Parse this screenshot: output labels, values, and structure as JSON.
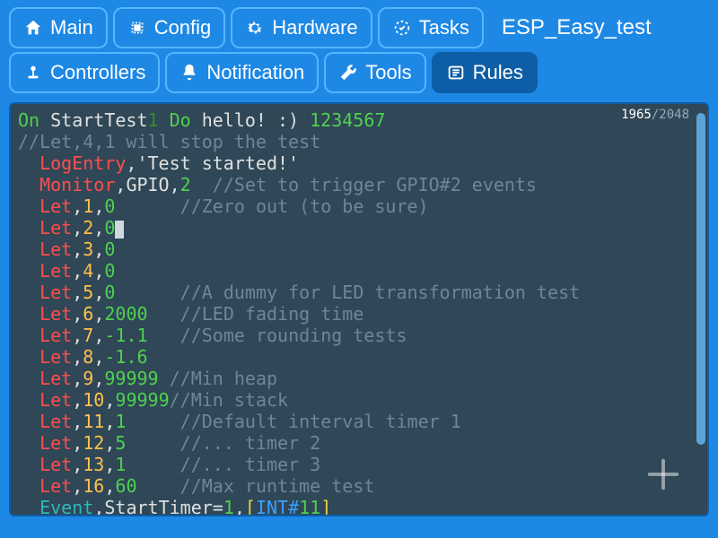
{
  "app_title": "ESP_Easy_test",
  "tabs_row1": [
    {
      "id": "main",
      "label": "Main",
      "icon": "home"
    },
    {
      "id": "config",
      "label": "Config",
      "icon": "chip"
    },
    {
      "id": "hardware",
      "label": "Hardware",
      "icon": "gear"
    },
    {
      "id": "tasks",
      "label": "Tasks",
      "icon": "tasks"
    }
  ],
  "tabs_row2": [
    {
      "id": "controllers",
      "label": "Controllers",
      "icon": "joystick"
    },
    {
      "id": "notification",
      "label": "Notification",
      "icon": "bell"
    },
    {
      "id": "tools",
      "label": "Tools",
      "icon": "wrench"
    },
    {
      "id": "rules",
      "label": "Rules",
      "icon": "list",
      "active": true
    }
  ],
  "counter": {
    "current": "1965",
    "max": "2048"
  },
  "code": {
    "lines": [
      [
        {
          "cls": "kw",
          "t": "On "
        },
        {
          "cls": "txt",
          "t": "StartTest"
        },
        {
          "cls": "kw-dk",
          "t": "1 "
        },
        {
          "cls": "kw",
          "t": "Do "
        },
        {
          "cls": "txt",
          "t": "hello! :) "
        },
        {
          "cls": "kw",
          "t": "1234567"
        }
      ],
      [
        {
          "cls": "com",
          "t": "//Let,4,1 will stop the test"
        }
      ],
      [
        {
          "cls": "txt",
          "t": "  "
        },
        {
          "cls": "cmd",
          "t": "LogEntry"
        },
        {
          "cls": "txt",
          "t": ","
        },
        {
          "cls": "txt",
          "t": "'Test started!'"
        }
      ],
      [
        {
          "cls": "txt",
          "t": "  "
        },
        {
          "cls": "cmd",
          "t": "Monitor"
        },
        {
          "cls": "txt",
          "t": ","
        },
        {
          "cls": "txt",
          "t": "GPIO,"
        },
        {
          "cls": "kw",
          "t": "2"
        },
        {
          "cls": "txt",
          "t": "  "
        },
        {
          "cls": "com",
          "t": "//Set to trigger GPIO#2 events"
        }
      ],
      [
        {
          "cls": "txt",
          "t": "  "
        },
        {
          "cls": "cmd",
          "t": "Let"
        },
        {
          "cls": "txt",
          "t": ","
        },
        {
          "cls": "num",
          "t": "1"
        },
        {
          "cls": "txt",
          "t": ","
        },
        {
          "cls": "kw",
          "t": "0"
        },
        {
          "cls": "txt",
          "t": "      "
        },
        {
          "cls": "com",
          "t": "//Zero out (to be sure)"
        }
      ],
      [
        {
          "cls": "txt",
          "t": "  "
        },
        {
          "cls": "cmd",
          "t": "Let"
        },
        {
          "cls": "txt",
          "t": ","
        },
        {
          "cls": "num",
          "t": "2"
        },
        {
          "cls": "txt",
          "t": ","
        },
        {
          "cls": "kw",
          "t": "0"
        },
        {
          "cls": "cursor",
          "t": ""
        }
      ],
      [
        {
          "cls": "txt",
          "t": "  "
        },
        {
          "cls": "cmd",
          "t": "Let"
        },
        {
          "cls": "txt",
          "t": ","
        },
        {
          "cls": "num",
          "t": "3"
        },
        {
          "cls": "txt",
          "t": ","
        },
        {
          "cls": "kw",
          "t": "0"
        }
      ],
      [
        {
          "cls": "txt",
          "t": "  "
        },
        {
          "cls": "cmd",
          "t": "Let"
        },
        {
          "cls": "txt",
          "t": ","
        },
        {
          "cls": "num",
          "t": "4"
        },
        {
          "cls": "txt",
          "t": ","
        },
        {
          "cls": "kw",
          "t": "0"
        }
      ],
      [
        {
          "cls": "txt",
          "t": "  "
        },
        {
          "cls": "cmd",
          "t": "Let"
        },
        {
          "cls": "txt",
          "t": ","
        },
        {
          "cls": "num",
          "t": "5"
        },
        {
          "cls": "txt",
          "t": ","
        },
        {
          "cls": "kw",
          "t": "0"
        },
        {
          "cls": "txt",
          "t": "      "
        },
        {
          "cls": "com",
          "t": "//A dummy for LED transformation test"
        }
      ],
      [
        {
          "cls": "txt",
          "t": "  "
        },
        {
          "cls": "cmd",
          "t": "Let"
        },
        {
          "cls": "txt",
          "t": ","
        },
        {
          "cls": "num",
          "t": "6"
        },
        {
          "cls": "txt",
          "t": ","
        },
        {
          "cls": "kw",
          "t": "2000"
        },
        {
          "cls": "txt",
          "t": "   "
        },
        {
          "cls": "com",
          "t": "//LED fading time"
        }
      ],
      [
        {
          "cls": "txt",
          "t": "  "
        },
        {
          "cls": "cmd",
          "t": "Let"
        },
        {
          "cls": "txt",
          "t": ","
        },
        {
          "cls": "num",
          "t": "7"
        },
        {
          "cls": "txt",
          "t": ","
        },
        {
          "cls": "kw",
          "t": "-1.1"
        },
        {
          "cls": "txt",
          "t": "   "
        },
        {
          "cls": "com",
          "t": "//Some rounding tests"
        }
      ],
      [
        {
          "cls": "txt",
          "t": "  "
        },
        {
          "cls": "cmd",
          "t": "Let"
        },
        {
          "cls": "txt",
          "t": ","
        },
        {
          "cls": "num",
          "t": "8"
        },
        {
          "cls": "txt",
          "t": ","
        },
        {
          "cls": "kw",
          "t": "-1.6"
        }
      ],
      [
        {
          "cls": "txt",
          "t": "  "
        },
        {
          "cls": "cmd",
          "t": "Let"
        },
        {
          "cls": "txt",
          "t": ","
        },
        {
          "cls": "num",
          "t": "9"
        },
        {
          "cls": "txt",
          "t": ","
        },
        {
          "cls": "kw",
          "t": "99999"
        },
        {
          "cls": "txt",
          "t": " "
        },
        {
          "cls": "com",
          "t": "//Min heap"
        }
      ],
      [
        {
          "cls": "txt",
          "t": "  "
        },
        {
          "cls": "cmd",
          "t": "Let"
        },
        {
          "cls": "txt",
          "t": ","
        },
        {
          "cls": "num",
          "t": "10"
        },
        {
          "cls": "txt",
          "t": ","
        },
        {
          "cls": "kw",
          "t": "99999"
        },
        {
          "cls": "com",
          "t": "//Min stack"
        }
      ],
      [
        {
          "cls": "txt",
          "t": "  "
        },
        {
          "cls": "cmd",
          "t": "Let"
        },
        {
          "cls": "txt",
          "t": ","
        },
        {
          "cls": "num",
          "t": "11"
        },
        {
          "cls": "txt",
          "t": ","
        },
        {
          "cls": "kw",
          "t": "1"
        },
        {
          "cls": "txt",
          "t": "     "
        },
        {
          "cls": "com",
          "t": "//Default interval timer 1"
        }
      ],
      [
        {
          "cls": "txt",
          "t": "  "
        },
        {
          "cls": "cmd",
          "t": "Let"
        },
        {
          "cls": "txt",
          "t": ","
        },
        {
          "cls": "num",
          "t": "12"
        },
        {
          "cls": "txt",
          "t": ","
        },
        {
          "cls": "kw",
          "t": "5"
        },
        {
          "cls": "txt",
          "t": "     "
        },
        {
          "cls": "com",
          "t": "//... timer 2"
        }
      ],
      [
        {
          "cls": "txt",
          "t": "  "
        },
        {
          "cls": "cmd",
          "t": "Let"
        },
        {
          "cls": "txt",
          "t": ","
        },
        {
          "cls": "num",
          "t": "13"
        },
        {
          "cls": "txt",
          "t": ","
        },
        {
          "cls": "kw",
          "t": "1"
        },
        {
          "cls": "txt",
          "t": "     "
        },
        {
          "cls": "com",
          "t": "//... timer 3"
        }
      ],
      [
        {
          "cls": "txt",
          "t": "  "
        },
        {
          "cls": "cmd",
          "t": "Let"
        },
        {
          "cls": "txt",
          "t": ","
        },
        {
          "cls": "num",
          "t": "16"
        },
        {
          "cls": "txt",
          "t": ","
        },
        {
          "cls": "kw",
          "t": "60"
        },
        {
          "cls": "txt",
          "t": "    "
        },
        {
          "cls": "com",
          "t": "//Max runtime test"
        }
      ],
      [
        {
          "cls": "txt",
          "t": "  "
        },
        {
          "cls": "cyan",
          "t": "Event"
        },
        {
          "cls": "txt",
          "t": ","
        },
        {
          "cls": "txt",
          "t": "StartTimer="
        },
        {
          "cls": "kw",
          "t": "1"
        },
        {
          "cls": "txt",
          "t": ","
        },
        {
          "cls": "yel",
          "t": "["
        },
        {
          "cls": "blue",
          "t": "INT#"
        },
        {
          "cls": "kw",
          "t": "11"
        },
        {
          "cls": "yel",
          "t": "]"
        }
      ]
    ]
  }
}
